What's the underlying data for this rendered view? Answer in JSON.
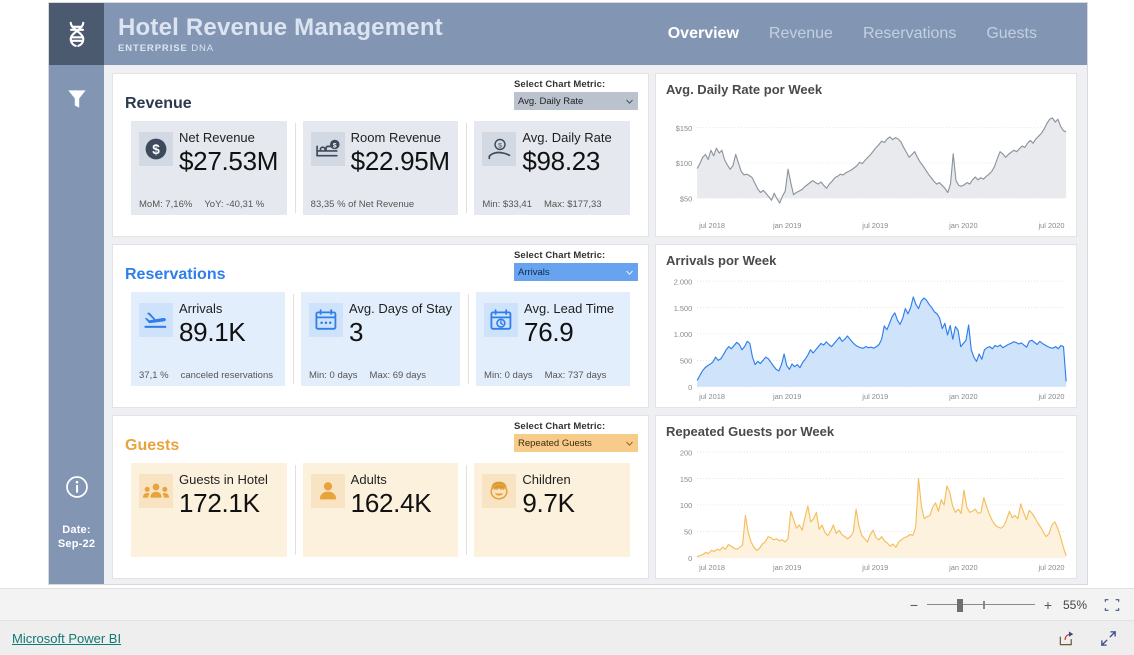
{
  "header": {
    "title": "Hotel Revenue Management",
    "brand_bold": "ENTERPRISE",
    "brand_light": "DNA",
    "logo_icon": "dna-icon",
    "nav": [
      {
        "label": "Overview",
        "active": true
      },
      {
        "label": "Revenue",
        "active": false
      },
      {
        "label": "Reservations",
        "active": false
      },
      {
        "label": "Guests",
        "active": false
      }
    ]
  },
  "sidebar": {
    "filter_icon": "filter-funnel-icon",
    "info_icon": "info-circle-icon",
    "date_label": "Date:",
    "date_value": "Sep-22"
  },
  "sections": [
    {
      "key": "revenue",
      "title": "Revenue",
      "metric_label": "Select Chart Metric:",
      "metric_value": "Avg. Daily Rate",
      "accent": "#2b3a4d",
      "cards": [
        {
          "icon": "dollar-circle-icon",
          "title": "Net Revenue",
          "value": "$27.53M",
          "foot1": "MoM: 7,16%",
          "foot2": "YoY: -40,31 %"
        },
        {
          "icon": "bed-dollar-icon",
          "title": "Room Revenue",
          "value": "$22.95M",
          "foot1": "83,35 % of Net Revenue",
          "foot2": ""
        },
        {
          "icon": "hand-dollar-icon",
          "title": "Avg. Daily Rate",
          "value": "$98.23",
          "foot1": "Min: $33,41",
          "foot2": "Max:  $177,33"
        }
      ]
    },
    {
      "key": "reservations",
      "title": "Reservations",
      "metric_label": "Select Chart Metric:",
      "metric_value": "Arrivals",
      "accent": "#2e7eeb",
      "cards": [
        {
          "icon": "airplane-landing-icon",
          "title": "Arrivals",
          "value": "89.1K",
          "foot1": "37,1 %",
          "foot2": "canceled reservations"
        },
        {
          "icon": "calendar-days-icon",
          "title": "Avg. Days of Stay",
          "value": "3",
          "foot1": "Min: 0 days",
          "foot2": "Max:  69 days"
        },
        {
          "icon": "calendar-clock-icon",
          "title": "Avg. Lead Time",
          "value": "76.9",
          "foot1": "Min: 0 days",
          "foot2": "Max:  737 days"
        }
      ]
    },
    {
      "key": "guests",
      "title": "Guests",
      "metric_label": "Select Chart Metric:",
      "metric_value": "Repeated Guests",
      "accent": "#e8a33d",
      "cards": [
        {
          "icon": "people-group-icon",
          "title": "Guests in Hotel",
          "value": "172.1K",
          "foot1": "",
          "foot2": ""
        },
        {
          "icon": "person-icon",
          "title": "Adults",
          "value": "162.4K",
          "foot1": "",
          "foot2": ""
        },
        {
          "icon": "child-face-icon",
          "title": "Children",
          "value": "9.7K",
          "foot1": "",
          "foot2": ""
        }
      ]
    }
  ],
  "chart_data": [
    {
      "type": "area",
      "title": "Avg. Daily Rate por Week",
      "xlabel": "",
      "ylabel": "",
      "grid": true,
      "line_color": "#8c949e",
      "fill_color": "#e8eaed",
      "ylim": [
        25,
        175
      ],
      "yticks": [
        50,
        100,
        150
      ],
      "ytick_labels": [
        "$50",
        "$100",
        "$150"
      ],
      "xticks": [
        "jul 2018",
        "jan 2019",
        "jul 2019",
        "jan 2020",
        "jul 2020"
      ],
      "values": [
        92,
        99,
        108,
        112,
        105,
        118,
        110,
        121,
        114,
        118,
        104,
        97,
        91,
        96,
        112,
        100,
        88,
        83,
        84,
        82,
        79,
        71,
        63,
        58,
        61,
        57,
        52,
        47,
        57,
        49,
        43,
        53,
        60,
        91,
        72,
        55,
        58,
        60,
        62,
        66,
        69,
        72,
        75,
        72,
        70,
        73,
        68,
        64,
        70,
        74,
        79,
        81,
        84,
        83,
        86,
        88,
        90,
        93,
        96,
        101,
        99,
        104,
        108,
        112,
        117,
        122,
        126,
        131,
        129,
        134,
        137,
        133,
        136,
        134,
        130,
        122,
        115,
        108,
        112,
        116,
        108,
        101,
        96,
        90,
        84,
        79,
        74,
        70,
        72,
        68,
        64,
        58,
        70,
        113,
        75,
        68,
        67,
        69,
        72,
        70,
        76,
        80,
        76,
        79,
        77,
        81,
        84,
        88,
        95,
        106,
        116,
        113,
        108,
        112,
        115,
        118,
        116,
        120,
        124,
        122,
        128,
        132,
        128,
        134,
        138,
        142,
        148,
        156,
        162,
        164,
        158,
        162,
        152,
        146,
        144
      ]
    },
    {
      "type": "area",
      "title": "Arrivals por Week",
      "xlabel": "",
      "ylabel": "",
      "grid": true,
      "line_color": "#2e7eeb",
      "fill_color": "#cfe3fb",
      "ylim": [
        0,
        2000
      ],
      "yticks": [
        0,
        500,
        1000,
        1500,
        2000
      ],
      "ytick_labels": [
        "0",
        "500",
        "1.000",
        "1.500",
        "2.000"
      ],
      "xticks": [
        "jul 2018",
        "jan 2019",
        "jul 2019",
        "jan 2020",
        "jul 2020"
      ],
      "values": [
        120,
        210,
        300,
        360,
        400,
        430,
        470,
        560,
        500,
        530,
        610,
        700,
        760,
        720,
        780,
        840,
        800,
        700,
        760,
        860,
        820,
        560,
        420,
        480,
        440,
        500,
        560,
        530,
        460,
        390,
        330,
        300,
        420,
        620,
        400,
        330,
        430,
        380,
        420,
        360,
        460,
        520,
        600,
        700,
        640,
        700,
        760,
        820,
        790,
        850,
        800,
        760,
        820,
        880,
        940,
        860,
        900,
        960,
        900,
        840,
        790,
        760,
        740,
        730,
        760,
        740,
        750,
        730,
        760,
        800,
        900,
        1150,
        1080,
        1200,
        1330,
        1400,
        1260,
        1180,
        1300,
        1480,
        1380,
        1500,
        1700,
        1560,
        1480,
        1620,
        1680,
        1640,
        1560,
        1500,
        1420,
        1380,
        1300,
        1100,
        1200,
        980,
        1160,
        900,
        1140,
        1070,
        760,
        820,
        880,
        1170,
        700,
        560,
        480,
        620,
        520,
        700,
        740,
        760,
        720,
        780,
        760,
        790,
        740,
        770,
        800,
        820,
        850,
        840,
        810,
        830,
        790,
        750,
        860,
        880,
        840,
        800,
        860,
        820,
        790,
        760,
        740,
        730,
        760,
        720,
        780,
        760,
        100
      ]
    },
    {
      "type": "area",
      "title": "Repeated Guests por Week",
      "xlabel": "",
      "ylabel": "",
      "grid": true,
      "line_color": "#f5bd5c",
      "fill_color": "#fdf2de",
      "ylim": [
        0,
        200
      ],
      "yticks": [
        0,
        50,
        100,
        150,
        200
      ],
      "ytick_labels": [
        "0",
        "50",
        "100",
        "150",
        "200"
      ],
      "xticks": [
        "jul 2018",
        "jan 2019",
        "jul 2019",
        "jan 2020",
        "jul 2020"
      ],
      "values": [
        2,
        4,
        6,
        10,
        8,
        14,
        12,
        16,
        14,
        20,
        16,
        25,
        22,
        18,
        16,
        20,
        24,
        80,
        48,
        30,
        20,
        14,
        18,
        26,
        30,
        40,
        38,
        34,
        36,
        32,
        34,
        30,
        36,
        88,
        72,
        56,
        62,
        52,
        76,
        98,
        68,
        74,
        86,
        54,
        62,
        48,
        42,
        50,
        62,
        46,
        52,
        44,
        40,
        36,
        40,
        48,
        92,
        60,
        42,
        36,
        30,
        44,
        52,
        38,
        34,
        40,
        32,
        28,
        22,
        26,
        20,
        30,
        34,
        38,
        40,
        44,
        42,
        58,
        150,
        98,
        74,
        78,
        80,
        96,
        104,
        88,
        110,
        100,
        136,
        124,
        98,
        86,
        92,
        84,
        128,
        96,
        86,
        88,
        92,
        84,
        86,
        114,
        96,
        82,
        70,
        62,
        58,
        56,
        60,
        72,
        88,
        76,
        80,
        74,
        102,
        86,
        72,
        90,
        84,
        76,
        66,
        58,
        48,
        40,
        46,
        62,
        68,
        56,
        40,
        20,
        4
      ]
    }
  ],
  "statusbar": {
    "zoom_minus": "−",
    "zoom_plus": "+",
    "zoom_percent": "55%",
    "fit_icon": "fit-to-page-icon"
  },
  "footer": {
    "link": "Microsoft Power BI",
    "share_icon": "share-icon",
    "fullscreen_icon": "fullscreen-arrows-icon"
  }
}
